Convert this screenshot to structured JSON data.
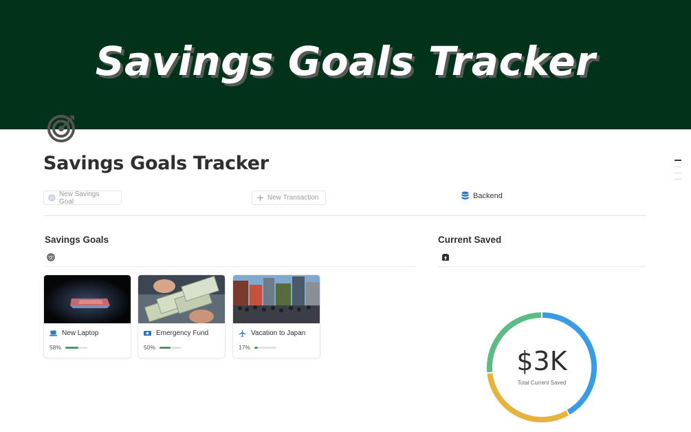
{
  "banner": {
    "title": "Savings Goals Tracker"
  },
  "page": {
    "title": "Savings Goals Tracker",
    "icon": "target-icon"
  },
  "buttons": {
    "new_goal": "New Savings Goal",
    "new_transaction": "New Transaction",
    "backend": "Backend"
  },
  "sections": {
    "goals_title": "Savings Goals",
    "saved_title": "Current Saved"
  },
  "goals": [
    {
      "name": "New Laptop",
      "icon": "laptop-icon",
      "progress_label": "58%",
      "progress": 0.58
    },
    {
      "name": "Emergency Fund",
      "icon": "money-icon",
      "progress_label": "50%",
      "progress": 0.5
    },
    {
      "name": "Vacation to Japan",
      "icon": "airplane-icon",
      "progress_label": "17%",
      "progress": 0.17
    }
  ],
  "chart_data": {
    "type": "pie",
    "title": "",
    "center_value": "$3K",
    "center_label": "Total Current Saved",
    "categories": [
      "New Laptop",
      "Emergency Fund",
      "Vacation to Japan"
    ],
    "values": [
      1.25,
      0.95,
      0.8
    ],
    "colors": [
      "#3a9be6",
      "#e6b43c",
      "#5dbb85"
    ]
  },
  "colors": {
    "banner_bg": "#00331a",
    "progress_fill": "#4f9768",
    "backend_icon": "#2f75c5"
  }
}
